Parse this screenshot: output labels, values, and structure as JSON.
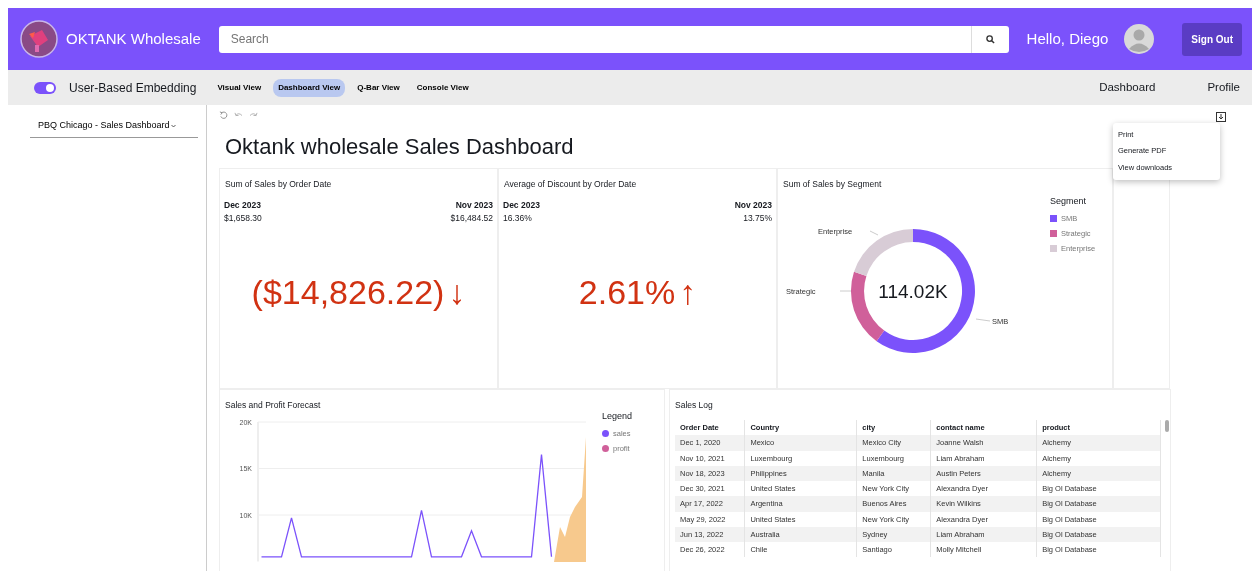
{
  "header": {
    "brand": "OKTANK Wholesale",
    "search": {
      "placeholder": "Search"
    },
    "greeting": "Hello, Diego",
    "sign_out": "Sign Out"
  },
  "toolbar": {
    "embedding_toggle": {
      "label": "User-Based Embedding",
      "on": true
    },
    "views": [
      {
        "label": "Visual View",
        "selected": false
      },
      {
        "label": "Dashboard View",
        "selected": true
      },
      {
        "label": "Q-Bar View",
        "selected": false
      },
      {
        "label": "Console View",
        "selected": false
      }
    ],
    "links": [
      "Dashboard",
      "Profile"
    ]
  },
  "sidebar": {
    "dashboard_select": "PBQ Chicago - Sales Dashboard"
  },
  "dashboard": {
    "title": "Oktank wholesale Sales Dashboard",
    "export_menu": [
      "Print",
      "Generate PDF",
      "View downloads"
    ],
    "kpis": [
      {
        "title": "Sum of Sales by Order Date",
        "left_label": "Dec 2023",
        "left_value": "$1,658.30",
        "right_label": "Nov 2023",
        "right_value": "$16,484.52",
        "value": "($14,826.22)",
        "arrow": "↓"
      },
      {
        "title": "Average of Discount by Order Date",
        "left_label": "Dec 2023",
        "left_value": "16.36%",
        "right_label": "Nov 2023",
        "right_value": "13.75%",
        "value": "2.61%",
        "arrow": "↑"
      }
    ],
    "segment": {
      "title": "Sum of Sales by Segment",
      "center": "114.02K",
      "slices": [
        {
          "label": "SMB",
          "color": "#7b52fb"
        },
        {
          "label": "Strategic",
          "color": "#d0609a"
        },
        {
          "label": "Enterprise",
          "color": "#d8ccd6"
        }
      ],
      "legend_title": "Segment",
      "legend": [
        {
          "label": "SMB",
          "color": "#7b52fb"
        },
        {
          "label": "Strategic",
          "color": "#d0609a"
        },
        {
          "label": "Enterprise",
          "color": "#d8ccd6"
        }
      ]
    },
    "forecast": {
      "title": "Sales and Profit Forecast",
      "legend_title": "Legend",
      "chart_data": {
        "type": "line",
        "grid": true,
        "ylim": [
          5000,
          20000
        ],
        "yticks": [
          {
            "value": 10000,
            "label": "10K"
          },
          {
            "value": 15000,
            "label": "15K"
          },
          {
            "value": 20000,
            "label": "20K"
          }
        ],
        "series": [
          {
            "name": "sales",
            "color": "#7b52fb",
            "values": [
              5500,
              5500,
              5500,
              9700,
              5500,
              5500,
              5500,
              5500,
              5500,
              5500,
              5500,
              5500,
              5500,
              5500,
              5500,
              5500,
              10500,
              5500,
              5500,
              5500,
              5500,
              8300,
              5500,
              5500,
              5500,
              5500,
              5500,
              5500,
              16500,
              5500,
              null,
              null,
              null
            ]
          },
          {
            "name": "profit",
            "color": "#d0609a",
            "values": [
              null,
              null,
              null,
              null,
              null,
              null,
              null,
              null,
              null,
              null,
              null,
              null,
              null,
              null,
              null,
              null,
              null,
              null,
              null,
              null,
              null,
              null,
              null,
              null,
              null,
              null,
              null,
              null,
              null,
              null,
              null,
              null,
              null
            ]
          }
        ]
      }
    },
    "sales_log": {
      "title": "Sales Log",
      "columns": [
        "Order Date",
        "Country",
        "city",
        "contact name",
        "product"
      ],
      "rows": [
        [
          "Dec 1, 2020",
          "Mexico",
          "Mexico City",
          "Joanne Walsh",
          "Alchemy"
        ],
        [
          "Nov 10, 2021",
          "Luxembourg",
          "Luxembourg",
          "Liam Abraham",
          "Alchemy"
        ],
        [
          "Nov 18, 2023",
          "Philippines",
          "Manila",
          "Austin Peters",
          "Alchemy"
        ],
        [
          "Dec 30, 2021",
          "United States",
          "New York City",
          "Alexandra Dyer",
          "Big Ol Database"
        ],
        [
          "Apr 17, 2022",
          "Argentina",
          "Buenos Aires",
          "Kevin Wilkins",
          "Big Ol Database"
        ],
        [
          "May 29, 2022",
          "United States",
          "New York City",
          "Alexandra Dyer",
          "Big Ol Database"
        ],
        [
          "Jun 13, 2022",
          "Australia",
          "Sydney",
          "Liam Abraham",
          "Big Ol Database"
        ],
        [
          "Dec 26, 2022",
          "Chile",
          "Santiago",
          "Molly Mitchell",
          "Big Ol Database"
        ]
      ]
    }
  }
}
